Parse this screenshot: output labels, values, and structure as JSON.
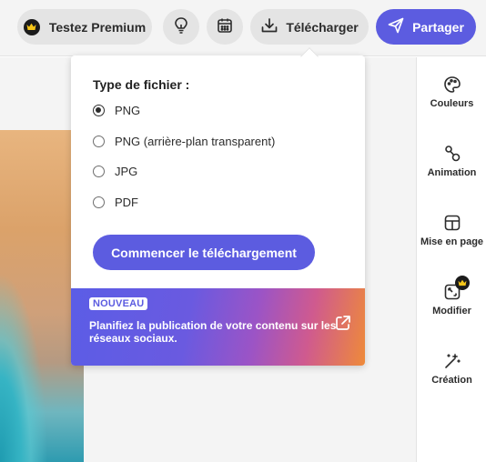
{
  "topbar": {
    "premium_label": "Testez Premium",
    "download_label": "Télécharger",
    "share_label": "Partager",
    "icons": {
      "premium": "crown-icon",
      "idea": "lightbulb-icon",
      "schedule": "calendar-icon",
      "download": "download-icon",
      "share": "send-icon"
    }
  },
  "colors": {
    "accent": "#5c5ce0",
    "premium_gold": "#f5c518"
  },
  "popover": {
    "title": "Type de fichier :",
    "options": [
      {
        "label": "PNG",
        "selected": true
      },
      {
        "label": "PNG (arrière-plan transparent)",
        "selected": false
      },
      {
        "label": "JPG",
        "selected": false
      },
      {
        "label": "PDF",
        "selected": false
      }
    ],
    "start_button": "Commencer le téléchargement",
    "promo": {
      "badge": "NOUVEAU",
      "text": "Planifiez la publication de votre contenu sur les réseaux sociaux.",
      "icon": "external-link-icon"
    }
  },
  "sidebar": {
    "items": [
      {
        "label": "Couleurs",
        "icon": "palette-icon"
      },
      {
        "label": "Animation",
        "icon": "animation-icon"
      },
      {
        "label": "Mise en page",
        "icon": "layout-icon"
      },
      {
        "label": "Modifier",
        "icon": "resize-icon",
        "premium": true
      },
      {
        "label": "Création",
        "icon": "magic-wand-icon"
      }
    ]
  }
}
